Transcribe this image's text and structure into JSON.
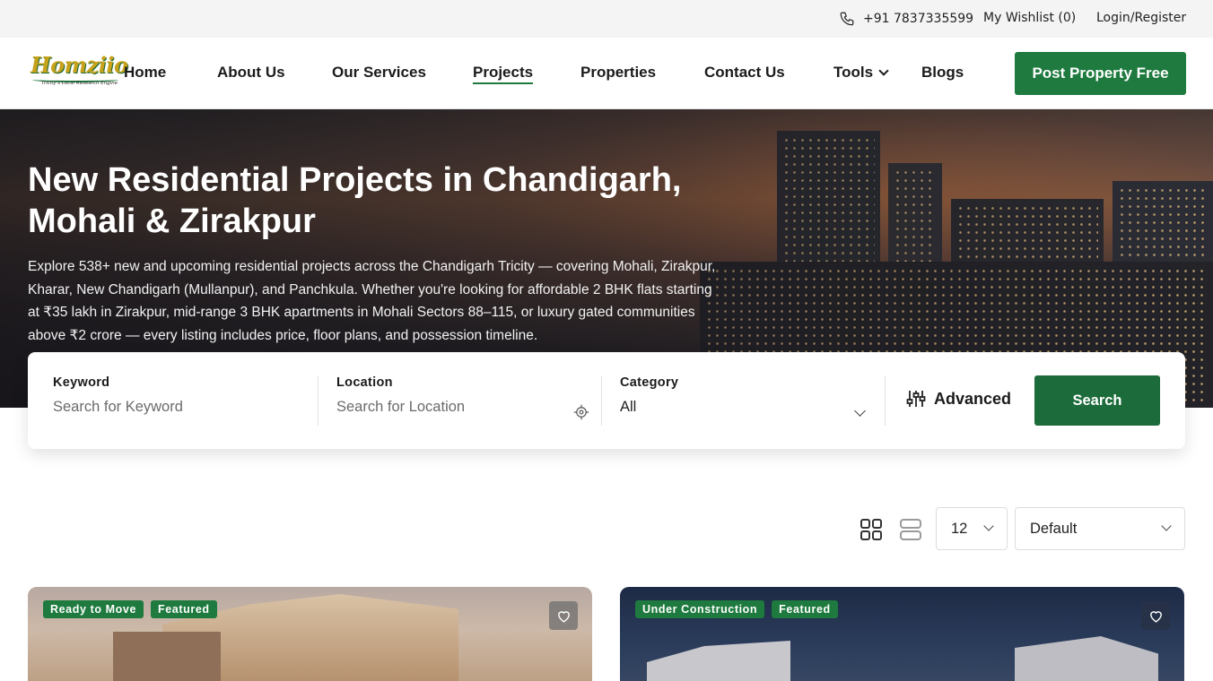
{
  "topbar": {
    "phone": "+91 7837335599",
    "wishlist": "My Wishlist (0)",
    "login": "Login/Register"
  },
  "header": {
    "logo_text": "Homziio",
    "logo_tagline": "Tricity's Local Research Engine",
    "nav": [
      {
        "label": "Home"
      },
      {
        "label": "About Us"
      },
      {
        "label": "Our Services"
      },
      {
        "label": "Projects",
        "active": true
      },
      {
        "label": "Properties"
      },
      {
        "label": "Contact Us"
      },
      {
        "label": "Tools",
        "dropdown": true
      },
      {
        "label": "Blogs"
      }
    ],
    "cta": "Post Property Free"
  },
  "hero": {
    "title": "New Residential Projects in Chandigarh, Mohali & Zirakpur",
    "description": "Explore 538+ new and upcoming residential projects across the Chandigarh Tricity — covering Mohali, Zirakpur, Kharar, New Chandigarh (Mullanpur), and Panchkula. Whether you're looking for affordable 2 BHK flats starting at ₹35 lakh in Zirakpur, mid-range 3 BHK apartments in Mohali Sectors 88–115, or luxury gated communities above ₹2 crore — every listing includes price, floor plans, and possession timeline."
  },
  "search": {
    "keyword_label": "Keyword",
    "keyword_placeholder": "Search for Keyword",
    "location_label": "Location",
    "location_placeholder": "Search for Location",
    "category_label": "Category",
    "category_value": "All",
    "advanced_label": "Advanced",
    "search_button": "Search"
  },
  "toolbar": {
    "per_page": "12",
    "sort": "Default"
  },
  "listings": [
    {
      "badges": [
        "Ready to Move",
        "Featured"
      ]
    },
    {
      "badges": [
        "Under Construction",
        "Featured"
      ]
    }
  ],
  "colors": {
    "brand_green": "#1e7a3e",
    "search_green": "#1c6b3b"
  }
}
